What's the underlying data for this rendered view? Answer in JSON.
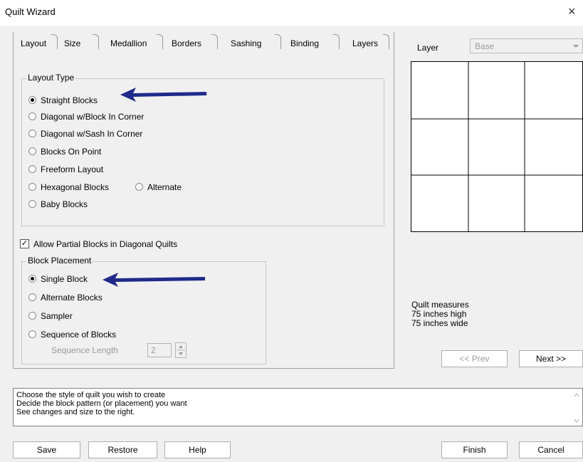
{
  "window": {
    "title": "Quilt Wizard",
    "close_glyph": "×"
  },
  "tabs": [
    "Layout",
    "Size",
    "Medallion",
    "Borders",
    "Sashing",
    "Binding",
    "Layers"
  ],
  "layout_type": {
    "label": "Layout Type",
    "options": [
      "Straight Blocks",
      "Diagonal w/Block In Corner",
      "Diagonal w/Sash In Corner",
      "Blocks On Point",
      "Freeform Layout",
      "Hexagonal Blocks",
      "Baby Blocks"
    ],
    "alternate_label": "Alternate",
    "selected": "Straight Blocks"
  },
  "allow_partial": {
    "label": "Allow Partial Blocks in Diagonal Quilts",
    "checked": true,
    "mark": "✓"
  },
  "block_placement": {
    "label": "Block Placement",
    "options": [
      "Single Block",
      "Alternate Blocks",
      "Sampler",
      "Sequence of Blocks"
    ],
    "selected": "Single Block",
    "sequence_length_label": "Sequence Length",
    "sequence_length_value": "2"
  },
  "layer": {
    "label": "Layer",
    "value": "Base"
  },
  "quilt_info": {
    "line1": "Quilt measures",
    "line2": "75 inches high",
    "line3": "75 inches wide"
  },
  "nav": {
    "prev": "<< Prev",
    "next": "Next >>"
  },
  "description": {
    "line1": "Choose the style of quilt you wish to create",
    "line2": "Decide the block pattern (or placement) you want",
    "line3": "See changes and size to the right."
  },
  "buttons": {
    "save": "Save",
    "restore": "Restore",
    "help": "Help",
    "finish": "Finish",
    "cancel": "Cancel"
  },
  "colors": {
    "arrow": "#1f2a8a",
    "background": "#f0f0f0"
  }
}
